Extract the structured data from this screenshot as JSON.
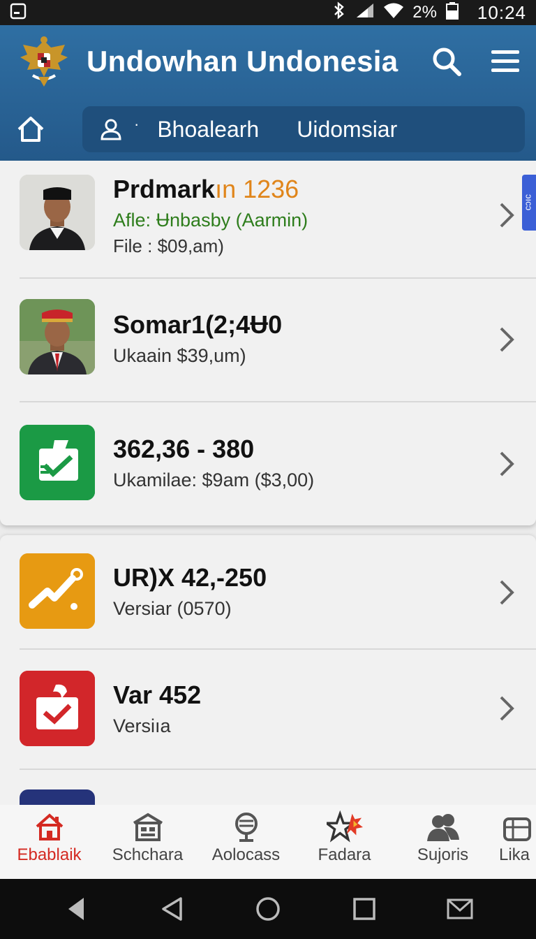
{
  "status_bar": {
    "battery": "2%",
    "time": "10:24"
  },
  "header": {
    "title": "Undowhan Undonesia",
    "search_tabs": [
      "Bhoalearh",
      "Uidomsiar"
    ],
    "search_dot": "·"
  },
  "list_top": [
    {
      "title": "Prdmark",
      "title_accent": "ın 1236",
      "line2": "Afle: Ʉnbasby (Aarmin)",
      "line3": "File : $09,am)"
    },
    {
      "title": "Somar1(2;4Ʉ0",
      "line2": "Ukaain $39,um)"
    },
    {
      "title": "362,36 - 380",
      "line2": "Ukamilae: $9am ($3,00)"
    }
  ],
  "list_bottom": [
    {
      "title": "UR)X 42,-250",
      "line2": "Versiar (0570)"
    },
    {
      "title": "Var 452",
      "line2": "Versiıa"
    }
  ],
  "side_tab": "ɔıcɔ",
  "bottom_nav": [
    "Ebablaik",
    "Schchara",
    "Aolocass",
    "Fadara",
    "Sujoris",
    "Lika"
  ],
  "colors": {
    "header": "#2f6fa3",
    "active_nav": "#d42a22",
    "accent": "#e0851a",
    "green": "#2e7d1c"
  }
}
